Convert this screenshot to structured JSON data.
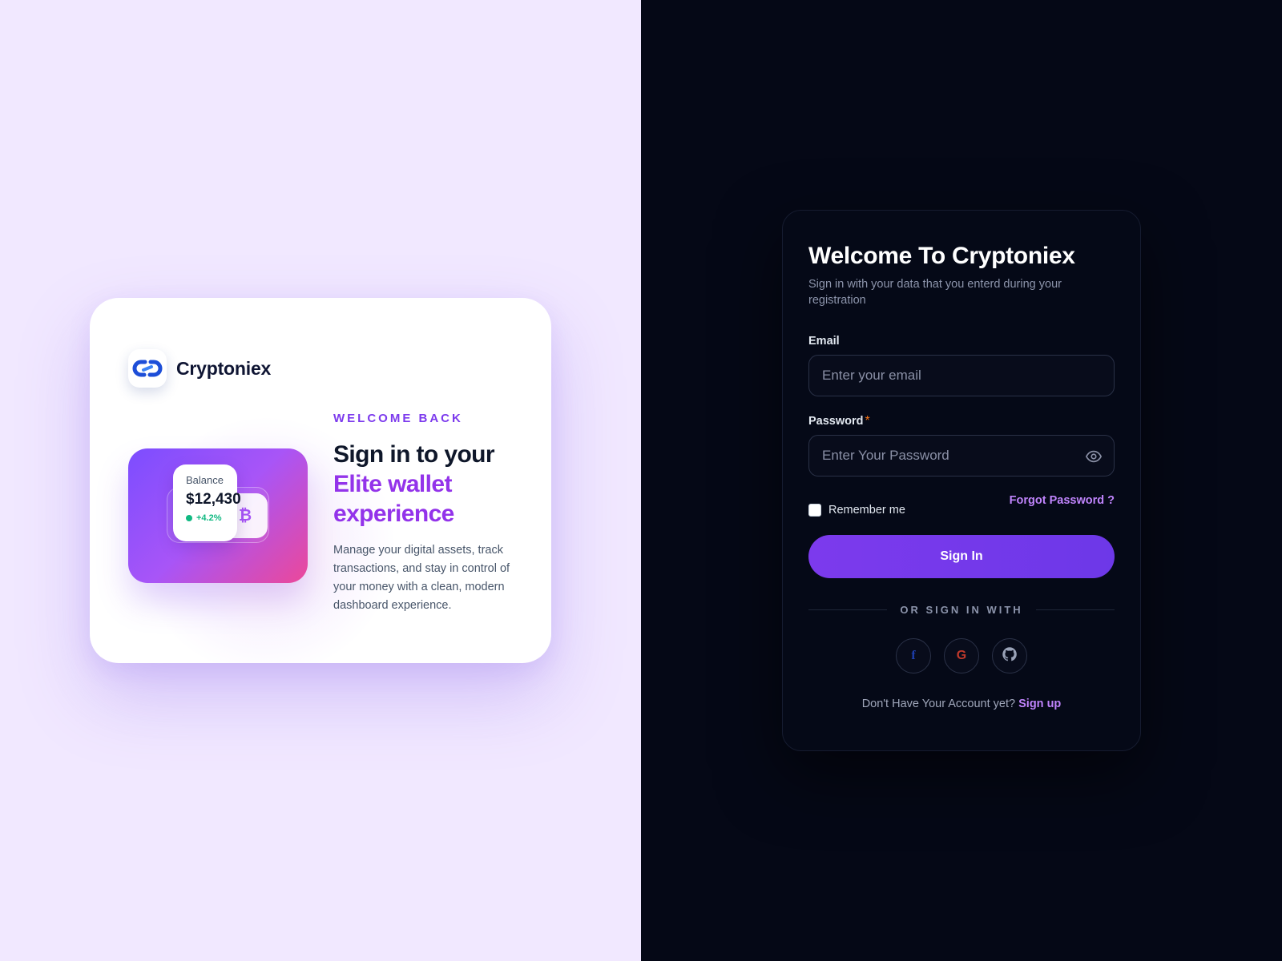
{
  "brand": {
    "name": "Cryptoniex",
    "logo_icon": "chain-link-icon",
    "wallet": {
      "balance_label": "Balance",
      "balance_value": "$12,430",
      "change": "+4.2%",
      "coin_icon": "bitcoin-icon",
      "coin_symbol": "₿"
    },
    "eyebrow": "WELCOME BACK",
    "headline_dark": "Sign in to your",
    "headline_accent_1": "Elite wallet",
    "headline_accent_2": "experience",
    "description": "Manage your digital assets, track transactions, and stay in control of your money with a clean, modern dashboard experience."
  },
  "login": {
    "title": "Welcome To Cryptoniex",
    "subtitle": "Sign in with your data that you enterd during your registration",
    "email_label": "Email",
    "email_placeholder": "Enter your email",
    "email_value": "",
    "password_label": "Password",
    "password_required_mark": "*",
    "password_placeholder": "Enter Your Password",
    "password_value": "",
    "remember_label": "Remember me",
    "remember_checked": false,
    "forgot_label": "Forgot Password ?",
    "signin_label": "Sign In",
    "divider_text": "OR SIGN IN WITH",
    "social_buttons": [
      {
        "name": "facebook",
        "icon": "facebook-icon",
        "glyph": "f",
        "color": "#1e40af"
      },
      {
        "name": "google",
        "icon": "google-icon",
        "glyph": "G",
        "color": "#c0392b"
      },
      {
        "name": "github",
        "icon": "github-icon",
        "color": "#9aa3b8"
      }
    ],
    "signup_prompt": "Don't Have Your Account yet?",
    "signup_link": "Sign up"
  },
  "colors": {
    "left_bg": "#f1e8ff",
    "right_bg": "#050816",
    "accent": "#7c3aed",
    "accent_light": "#c084fc",
    "success": "#10b981"
  }
}
